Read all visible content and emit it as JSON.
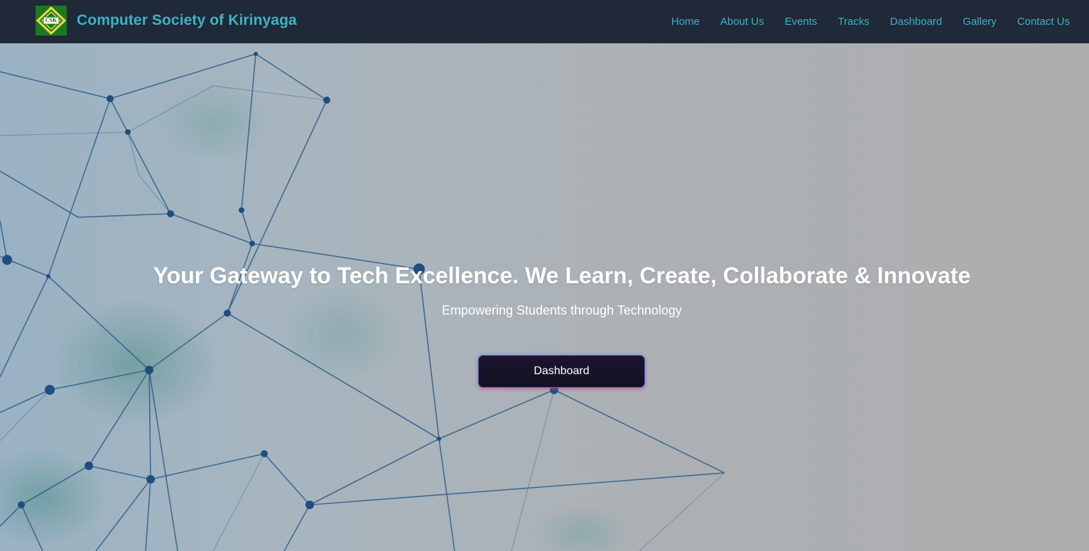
{
  "brand": {
    "logo_text": "CSK",
    "name": "Computer Society of Kirinyaga"
  },
  "nav": {
    "items": [
      {
        "label": "Home"
      },
      {
        "label": "About Us"
      },
      {
        "label": "Events"
      },
      {
        "label": "Tracks"
      },
      {
        "label": "Dashboard"
      },
      {
        "label": "Gallery"
      },
      {
        "label": "Contact Us"
      }
    ]
  },
  "hero": {
    "title": "Your Gateway to Tech Excellence. We Learn, Create, Collaborate & Innovate",
    "subtitle": "Empowering Students through Technology",
    "button_label": "Dashboard"
  },
  "colors": {
    "navbar_bg": "#1f2937",
    "accent": "#3bb3c7",
    "logo_green": "#1b7a1b",
    "logo_yellow": "#e6d84a",
    "button_bg": "#141020"
  }
}
